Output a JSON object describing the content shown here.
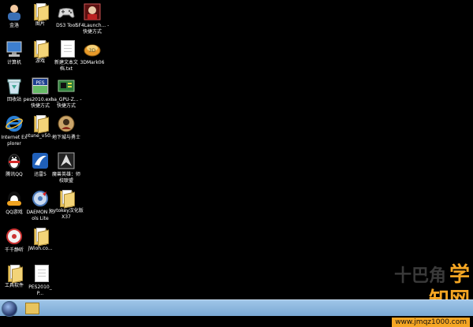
{
  "desktop": {
    "icons": [
      {
        "label": "金洛",
        "kind": "user"
      },
      {
        "label": "图片",
        "kind": "folder"
      },
      {
        "label": "DS3 Tool",
        "kind": "gamepad"
      },
      {
        "label": "SF4Launch... - 快捷方式",
        "kind": "game"
      },
      {
        "label": "计算机",
        "kind": "computer"
      },
      {
        "label": "游戏",
        "kind": "folder"
      },
      {
        "label": "新建文本文档.txt",
        "kind": "document"
      },
      {
        "label": "3DMark06",
        "kind": "3dmark"
      },
      {
        "label": "回收站",
        "kind": "recycle-bin"
      },
      {
        "label": "pes2010.exe - 快捷方式",
        "kind": "pes"
      },
      {
        "label": "ha_GPU-Z... - 快捷方式",
        "kind": "gpuz"
      },
      {
        "label": "Internet Explorer",
        "kind": "ie"
      },
      {
        "label": "ntune_v50...",
        "kind": "folder"
      },
      {
        "label": "地下城与勇士",
        "kind": "dnf"
      },
      {
        "label": "腾讯QQ",
        "kind": "qq"
      },
      {
        "label": "迅雷5",
        "kind": "thunder"
      },
      {
        "label": "魔兽英雄：师校联盟",
        "kind": "warcraft"
      },
      {
        "label": "QQ游戏",
        "kind": "qqgame"
      },
      {
        "label": "DAEMON Tools Lite",
        "kind": "daemon"
      },
      {
        "label": "Joytokey汉化版X37",
        "kind": "folder"
      },
      {
        "label": "千千静听",
        "kind": "ttplayer"
      },
      {
        "label": "jWioh.co...",
        "kind": "folder"
      },
      {
        "label": "工具软件",
        "kind": "folder"
      },
      {
        "label": "PES2010_P...",
        "kind": "document"
      }
    ]
  },
  "watermark": {
    "title": "学知网",
    "ghost": "十巴角",
    "url": "www.jmqz1000.com"
  },
  "taskbar": {
    "start_icon": "windows-orb-icon",
    "pinned": [
      "explorer-folder-icon"
    ]
  },
  "colors": {
    "desktop_bg": "#000000",
    "taskbar": "#8fb8df",
    "watermark": "#f5a623"
  }
}
